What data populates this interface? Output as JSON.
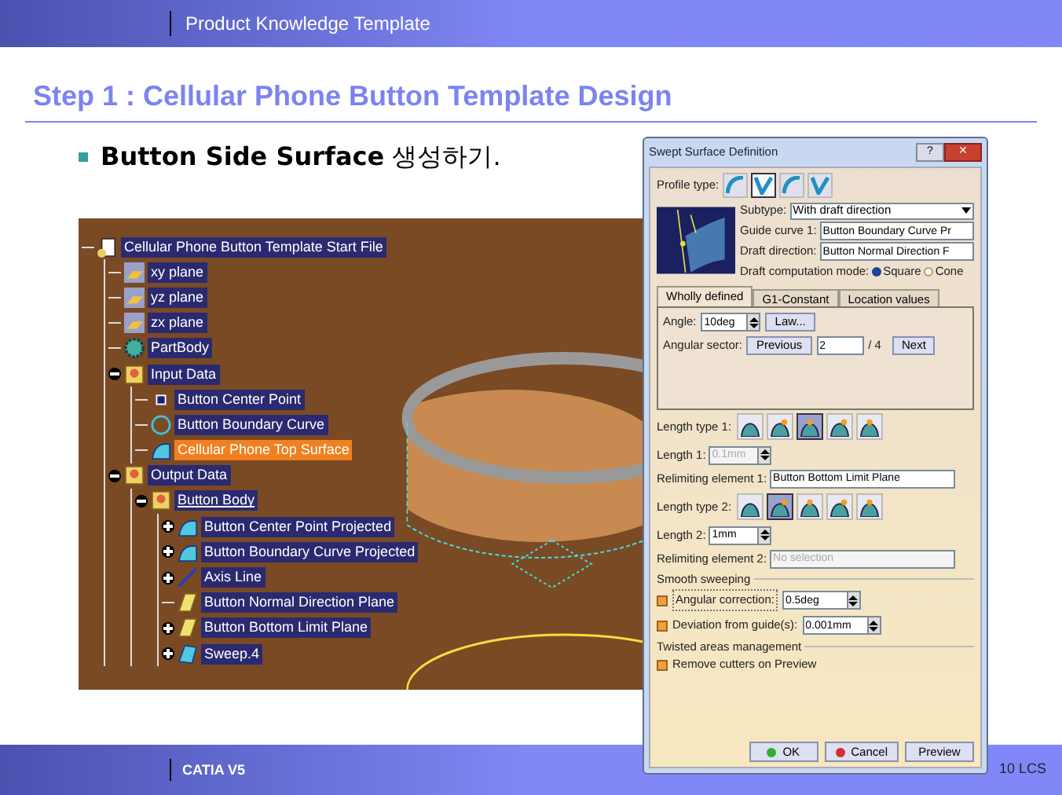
{
  "header": {
    "title": "Product Knowledge Template"
  },
  "slide_title": "Step 1 : Cellular Phone Button Template Design",
  "bullet": "**Button Side Surface** 생성하기.",
  "tree": {
    "label": "Cellular Phone Button Template Start File",
    "kind": "file",
    "selected": false,
    "children": [
      {
        "label": "xy plane",
        "kind": "plane",
        "selected": false
      },
      {
        "label": "yz plane",
        "kind": "plane",
        "selected": false
      },
      {
        "label": "zx plane",
        "kind": "plane",
        "selected": false
      },
      {
        "label": "PartBody",
        "kind": "gear",
        "selected": false
      },
      {
        "label": "Input Data",
        "kind": "set",
        "selected": false,
        "expanded": true,
        "children": [
          {
            "label": "Button Center Point",
            "kind": "point",
            "selected": false
          },
          {
            "label": "Button Boundary Curve",
            "kind": "curve",
            "selected": false
          },
          {
            "label": "Cellular Phone Top Surface",
            "kind": "surface",
            "selected": true
          }
        ]
      },
      {
        "label": "Output Data",
        "kind": "set",
        "selected": false,
        "expanded": true,
        "children": [
          {
            "label": "Button Body",
            "kind": "set",
            "selected": false,
            "underlined": true,
            "expanded": true,
            "children": [
              {
                "label": "Button Center Point Projected",
                "kind": "surface",
                "selected": false,
                "expanded": false
              },
              {
                "label": "Button Boundary Curve Projected",
                "kind": "surface",
                "selected": false,
                "expanded": false
              },
              {
                "label": "Axis Line",
                "kind": "line",
                "selected": false,
                "expanded": false
              },
              {
                "label": "Button Normal Direction Plane",
                "kind": "flat",
                "selected": false
              },
              {
                "label": "Button Bottom Limit Plane",
                "kind": "flat",
                "selected": false,
                "expanded": false
              },
              {
                "label": "Sweep.4",
                "kind": "sweep",
                "selected": false,
                "expanded": false
              }
            ]
          }
        ]
      }
    ]
  },
  "dialog": {
    "title": "Swept Surface Definition",
    "help_button": "?",
    "close_button": "✕",
    "profile_type": {
      "label": "Profile type:",
      "options": [
        {
          "selected": false
        },
        {
          "selected": true
        },
        {
          "selected": false
        },
        {
          "selected": false
        }
      ]
    },
    "subtype": {
      "label": "Subtype:",
      "value": "With draft direction"
    },
    "guide_curve": {
      "label": "Guide curve 1:",
      "value": "Button Boundary Curve Pr"
    },
    "draft_direction": {
      "label": "Draft direction:",
      "value": "Button Normal Direction F"
    },
    "draft_mode": {
      "label": "Draft computation mode:",
      "options": [
        {
          "label": "Square",
          "selected": true
        },
        {
          "label": "Cone",
          "selected": false
        }
      ]
    },
    "tabs": [
      {
        "label": "Wholly defined",
        "selected": true
      },
      {
        "label": "G1-Constant",
        "selected": false
      },
      {
        "label": "Location values",
        "selected": false
      }
    ],
    "angle": {
      "label": "Angle:",
      "value": "10deg",
      "law_button": "Law..."
    },
    "angular_sector": {
      "label": "Angular sector:",
      "previous": "Previous",
      "value": "2",
      "total": "/ 4",
      "next": "Next"
    },
    "length_type_1": {
      "label": "Length type 1:",
      "options": [
        {
          "selected": false
        },
        {
          "selected": false
        },
        {
          "selected": true
        },
        {
          "selected": false
        },
        {
          "selected": false
        }
      ]
    },
    "length_1": {
      "label": "Length 1:",
      "value": "0.1mm",
      "disabled": true
    },
    "relimiting_1": {
      "label": "Relimiting element 1:",
      "value": "Button Bottom Limit Plane"
    },
    "length_type_2": {
      "label": "Length type 2:",
      "options": [
        {
          "selected": false
        },
        {
          "selected": true
        },
        {
          "selected": false
        },
        {
          "selected": false
        },
        {
          "selected": false
        }
      ]
    },
    "length_2": {
      "label": "Length 2:",
      "value": "1mm"
    },
    "relimiting_2": {
      "label": "Relimiting element 2:",
      "placeholder": "No selection",
      "disabled": true
    },
    "smooth_sweeping": {
      "title": "Smooth sweeping",
      "options": [
        {
          "label": "Angular correction:",
          "checked": true,
          "value": "0.5deg"
        },
        {
          "label": "Deviation from guide(s):",
          "checked": true,
          "value": "0.001mm"
        }
      ]
    },
    "twisted_areas": {
      "title": "Twisted areas management",
      "option": {
        "label": "Remove cutters on Preview",
        "checked": true
      }
    },
    "buttons": [
      {
        "label": "OK",
        "kind": "ok"
      },
      {
        "label": "Cancel",
        "kind": "cancel"
      },
      {
        "label": "Preview",
        "kind": "plain"
      }
    ]
  },
  "footer": {
    "product": "CATIA V5",
    "page": "10 LCS"
  }
}
